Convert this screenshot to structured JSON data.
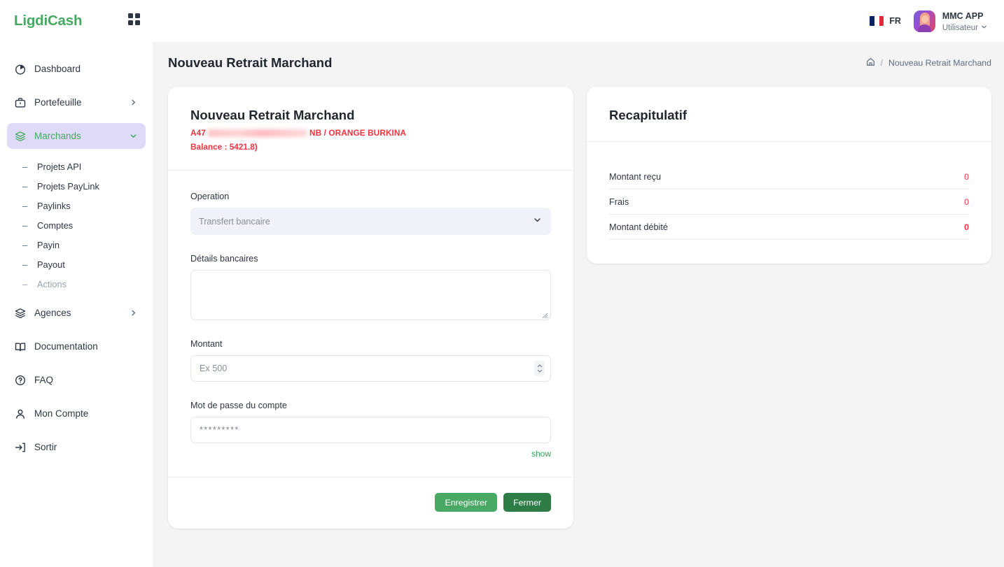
{
  "brand": {
    "name": "LigdiCash",
    "grid_icon": "grid-icon",
    "color": "#43aa60"
  },
  "sidebar": {
    "items": [
      {
        "label": "Dashboard",
        "icon": "pie-chart-icon",
        "caret": "",
        "active": false
      },
      {
        "label": "Portefeuille",
        "icon": "briefcase-icon",
        "caret": "chevron-right-icon",
        "active": false
      },
      {
        "label": "Marchands",
        "icon": "layers-icon",
        "caret": "chevron-down-icon",
        "active": true
      }
    ],
    "sub_items": [
      {
        "label": "Projets API",
        "muted": false
      },
      {
        "label": "Projets PayLink",
        "muted": false
      },
      {
        "label": "Paylinks",
        "muted": false
      },
      {
        "label": "Comptes",
        "muted": false
      },
      {
        "label": "Payin",
        "muted": false
      },
      {
        "label": "Payout",
        "muted": false
      },
      {
        "label": "Actions",
        "muted": true
      }
    ],
    "items_bottom": [
      {
        "label": "Agences",
        "icon": "layers-icon",
        "caret": "chevron-right-icon"
      },
      {
        "label": "Documentation",
        "icon": "book-icon",
        "caret": ""
      },
      {
        "label": "FAQ",
        "icon": "question-circle-icon",
        "caret": ""
      },
      {
        "label": "Mon Compte",
        "icon": "user-icon",
        "caret": ""
      },
      {
        "label": "Sortir",
        "icon": "logout-icon",
        "caret": ""
      }
    ]
  },
  "topbar": {
    "language_code": "FR",
    "language_flag": "france-flag-icon",
    "user_name": "MMC APP",
    "user_role": "Utilisateur",
    "user_caret": "chevron-down-icon"
  },
  "page": {
    "title": "Nouveau Retrait Marchand",
    "breadcrumb_home_icon": "home-icon",
    "breadcrumb_separator": "/",
    "breadcrumb_current": "Nouveau Retrait Marchand"
  },
  "form_card": {
    "title": "Nouveau Retrait Marchand",
    "merchant_prefix": "A47",
    "merchant_redacted": "redacted-text",
    "merchant_suffix": "NB / ORANGE BURKINA",
    "balance": "Balance : 5421.8)",
    "fields": {
      "operation_label": "Operation",
      "operation_value": "Transfert bancaire",
      "operation_caret": "chevron-down-icon",
      "bank_details_label": "Détails bancaires",
      "bank_details_value": "",
      "amount_label": "Montant",
      "amount_placeholder": "Ex 500",
      "amount_value": "",
      "password_label": "Mot de passe du compte",
      "password_masked": "*********",
      "show_link": "show"
    },
    "buttons": {
      "save": "Enregistrer",
      "close": "Fermer"
    }
  },
  "recap_card": {
    "title": "Recapitulatif",
    "rows": [
      {
        "label": "Montant reçu",
        "value": "0",
        "strong": false
      },
      {
        "label": "Frais",
        "value": "0",
        "strong": false
      },
      {
        "label": "Montant débité",
        "value": "0",
        "strong": true
      }
    ]
  },
  "colors": {
    "brand_green": "#43aa60",
    "active_bg": "#dedaf8",
    "danger_red": "#f5333f",
    "btn_save": "#48a864",
    "btn_close": "#2e7d47",
    "page_bg": "#f4f4f5"
  }
}
